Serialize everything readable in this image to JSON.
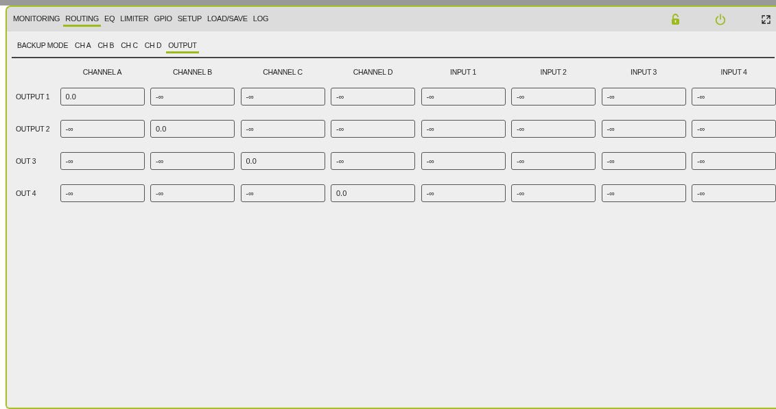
{
  "menu": [
    {
      "label": "MONITORING",
      "selected": false
    },
    {
      "label": "ROUTING",
      "selected": true
    },
    {
      "label": "EQ",
      "selected": false
    },
    {
      "label": "LIMITER",
      "selected": false
    },
    {
      "label": "GPIO",
      "selected": false
    },
    {
      "label": "SETUP",
      "selected": false
    },
    {
      "label": "LOAD/SAVE",
      "selected": false
    },
    {
      "label": "LOG",
      "selected": false
    }
  ],
  "subtabs": [
    {
      "label": "BACKUP MODE",
      "selected": false
    },
    {
      "label": "CH A",
      "selected": false
    },
    {
      "label": "CH B",
      "selected": false
    },
    {
      "label": "CH C",
      "selected": false
    },
    {
      "label": "CH D",
      "selected": false
    },
    {
      "label": "OUTPUT",
      "selected": true
    }
  ],
  "matrix": {
    "columns": [
      "CHANNEL A",
      "CHANNEL B",
      "CHANNEL C",
      "CHANNEL D",
      "INPUT 1",
      "INPUT 2",
      "INPUT 3",
      "INPUT 4"
    ],
    "rows": [
      {
        "label": "OUTPUT 1",
        "values": [
          "0.0",
          "-∞",
          "-∞",
          "-∞",
          "-∞",
          "-∞",
          "-∞",
          "-∞"
        ]
      },
      {
        "label": "OUTPUT 2",
        "values": [
          "-∞",
          "0.0",
          "-∞",
          "-∞",
          "-∞",
          "-∞",
          "-∞",
          "-∞"
        ]
      },
      {
        "label": "OUT 3",
        "values": [
          "-∞",
          "-∞",
          "0.0",
          "-∞",
          "-∞",
          "-∞",
          "-∞",
          "-∞"
        ]
      },
      {
        "label": "OUT 4",
        "values": [
          "-∞",
          "-∞",
          "-∞",
          "0.0",
          "-∞",
          "-∞",
          "-∞",
          "-∞"
        ]
      }
    ]
  }
}
